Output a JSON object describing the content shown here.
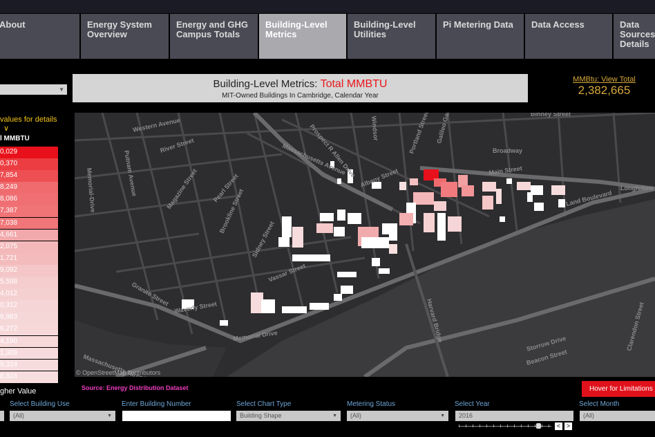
{
  "tabs": [
    {
      "label": "About"
    },
    {
      "label": "Energy System Overview"
    },
    {
      "label": "Energy and GHG Campus Totals"
    },
    {
      "label": "Building-Level Metrics"
    },
    {
      "label": "Building-Level Utilities"
    },
    {
      "label": "Pi Metering Data"
    },
    {
      "label": "Data Access"
    },
    {
      "label": "Data Sources Details"
    }
  ],
  "active_tab": "Building-Level Metrics",
  "title": {
    "prefix": "Building-Level Metrics:",
    "metric": "Total MMBTU",
    "subtitle": "MIT-Owned Buildings In Cambridge, Calendar Year"
  },
  "total": {
    "link": "MMBtu: View Total",
    "value": "2,382,665"
  },
  "left_panel": {
    "hint": "values for details",
    "hint_arrow": "∨",
    "column_header": "l MMBTU",
    "rows": [
      {
        "value": "0,029",
        "color": "#e8101a"
      },
      {
        "value": "0,370",
        "color": "#ec3e42"
      },
      {
        "value": "7,854",
        "color": "#ee4f53"
      },
      {
        "value": "8,249",
        "color": "#ef6b6e"
      },
      {
        "value": "8,086",
        "color": "#ef6f72"
      },
      {
        "value": "7,387",
        "color": "#f07376"
      },
      {
        "value": "7,038",
        "color": "#f07679"
      },
      {
        "value": "4,661",
        "color": "#f2a9ab"
      },
      {
        "value": "2,075",
        "color": "#f3b9ba"
      },
      {
        "value": "1,721",
        "color": "#f3bbbc"
      },
      {
        "value": "9,092",
        "color": "#f4c6c7"
      },
      {
        "value": "5,598",
        "color": "#f5cdce"
      },
      {
        "value": "4,012",
        "color": "#f5d0d1"
      },
      {
        "value": "0,312",
        "color": "#f6d5d6"
      },
      {
        "value": "6,983",
        "color": "#f6d7d8"
      },
      {
        "value": "6,272",
        "color": "#f6d8d9"
      },
      {
        "value": "4,190",
        "color": "#f7d9da"
      },
      {
        "value": "1,309",
        "color": "#f7dbdc"
      },
      {
        "value": "9,324",
        "color": "#f7dcdd"
      },
      {
        "value": "8,824",
        "color": "#f7dddd"
      }
    ],
    "legend_label": "gher Value"
  },
  "source": "Source: Energy Distribution Dataset",
  "hover_button": "Hover for Limitations",
  "map": {
    "attribution": "© OpenStreetMap contributors",
    "streets": [
      {
        "name": "Western Avenue"
      },
      {
        "name": "River Street"
      },
      {
        "name": "Putnam Avenue"
      },
      {
        "name": "Massachusetts Avenue"
      },
      {
        "name": "Magazine Street"
      },
      {
        "name": "Pearl Street"
      },
      {
        "name": "Brookline Street"
      },
      {
        "name": "Sidney Street"
      },
      {
        "name": "Albany Street"
      },
      {
        "name": "Portland Street"
      },
      {
        "name": "Galileo Galilei"
      },
      {
        "name": "Broadway"
      },
      {
        "name": "Main Street"
      },
      {
        "name": "Longfellow"
      },
      {
        "name": "Land Boulevard"
      },
      {
        "name": "Vassar Street"
      },
      {
        "name": "Waverly Street"
      },
      {
        "name": "Granite Street"
      },
      {
        "name": "Memorial Drive"
      },
      {
        "name": "Harvard Bridge"
      },
      {
        "name": "Storrow Drive"
      },
      {
        "name": "Beacon Street"
      },
      {
        "name": "Memorial-Drive"
      },
      {
        "name": "Massachusetts Turnpike"
      },
      {
        "name": "Binney Street"
      },
      {
        "name": "Windsor"
      },
      {
        "name": "Prospect R Allen Drive"
      },
      {
        "name": "Clarendon Street"
      }
    ]
  },
  "filters": [
    {
      "label": "",
      "value": ""
    },
    {
      "label": "Select Building Use",
      "value": "(All)"
    },
    {
      "label": "Enter Building Number",
      "value": ""
    },
    {
      "label": "Select Chart Type",
      "value": "Building Shape"
    },
    {
      "label": "Metering Status",
      "value": "(All)"
    },
    {
      "label": "Select Year",
      "value": "2016"
    },
    {
      "label": "Select Month",
      "value": "(All)"
    }
  ],
  "year_nav": {
    "prev": "<",
    "next": ">"
  }
}
